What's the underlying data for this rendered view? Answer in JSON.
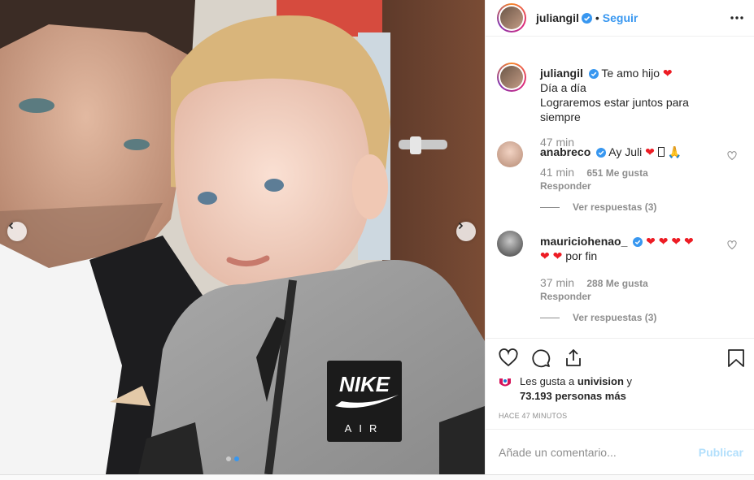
{
  "post": {
    "author": "juliangil",
    "follow_label": "Seguir",
    "separator": "•"
  },
  "caption": {
    "username": "juliangil",
    "line1": "Te amo hijo",
    "line2": "Día a día",
    "line3": "Lograremos estar juntos para siempre",
    "time": "47 min"
  },
  "comments": [
    {
      "username": "anabreco",
      "text": "Ay Juli",
      "time": "41 min",
      "likes": "651 Me gusta",
      "reply_label": "Responder",
      "view_replies": "Ver respuestas (3)"
    },
    {
      "username": "mauriciohenao_",
      "text": "por fin",
      "time": "37 min",
      "likes": "288 Me gusta",
      "reply_label": "Responder",
      "view_replies": "Ver respuestas (3)"
    }
  ],
  "likes": {
    "prefix": "Les gusta a",
    "account": "univision",
    "suffix": "y",
    "others": "73.193 personas más"
  },
  "timestamp": "HACE 47 MINUTOS",
  "composer": {
    "placeholder": "Añade un comentario...",
    "publish_label": "Publicar"
  },
  "carousel": {
    "total": 2,
    "active_index": 1
  },
  "colors": {
    "link": "#3897f0",
    "heart": "#ed1c24",
    "muted": "#8e8e8e",
    "publish_disabled": "#b2dffc"
  },
  "icons": [
    "chevron-left-icon",
    "chevron-right-icon",
    "more-icon",
    "verified-icon",
    "heart-icon",
    "comment-icon",
    "share-icon",
    "bookmark-icon"
  ]
}
